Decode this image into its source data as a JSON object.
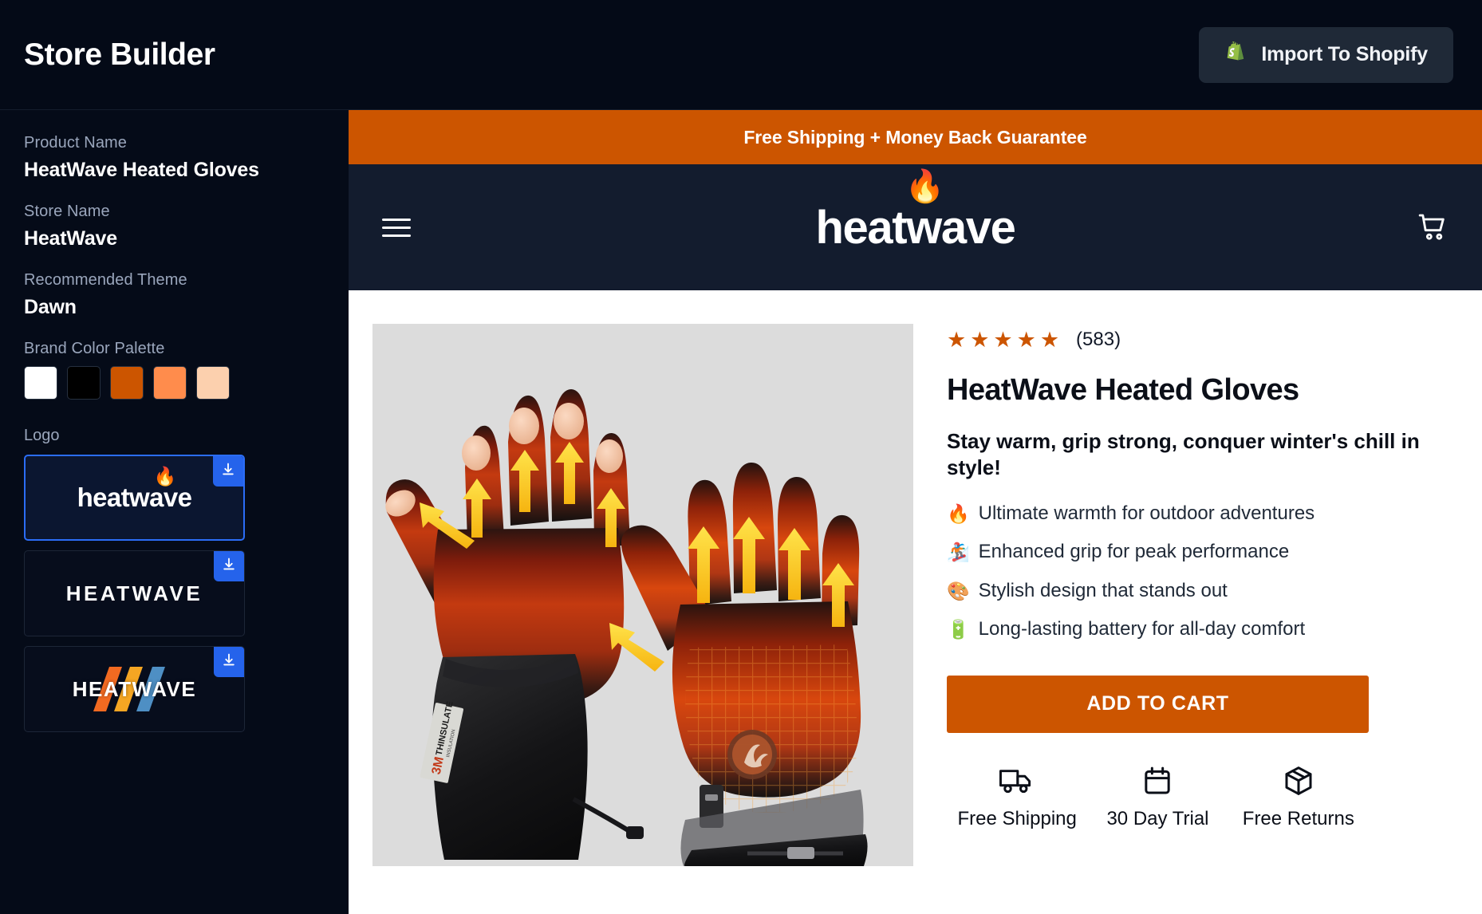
{
  "topbar": {
    "title": "Store Builder",
    "import_button": {
      "label": "Import To Shopify",
      "icon": "shopify-bag-icon"
    }
  },
  "sidebar": {
    "fields": [
      {
        "label": "Product Name",
        "value": "HeatWave Heated Gloves"
      },
      {
        "label": "Store Name",
        "value": "HeatWave"
      },
      {
        "label": "Recommended Theme",
        "value": "Dawn"
      }
    ],
    "palette": {
      "label": "Brand Color Palette",
      "colors": [
        "#FFFFFF",
        "#000000",
        "#CC5500",
        "#FF8C4C",
        "#FCD0AE"
      ]
    },
    "logo": {
      "label": "Logo",
      "items": [
        {
          "text": "heatwave",
          "style": "lowercase-flame",
          "selected": true,
          "download_label": "Download"
        },
        {
          "text": "HEATWAVE",
          "style": "uppercase-thin",
          "selected": false,
          "download_label": "Download"
        },
        {
          "text": "HEATWAVE",
          "style": "uppercase-wave-mark",
          "selected": false,
          "download_label": "Download"
        }
      ]
    }
  },
  "preview": {
    "promo_bar": "Free Shipping + Money Back Guarantee",
    "nav": {
      "menu_icon": "hamburger-icon",
      "logo_text": "heatwave",
      "cart_icon": "shopping-cart-icon"
    },
    "product": {
      "image_alt": "HeatWave Heated Gloves thermal heat-map product photo",
      "rating_stars": 5,
      "review_count": "(583)",
      "title": "HeatWave Heated Gloves",
      "tagline": "Stay warm, grip strong, conquer winter's chill in style!",
      "bullets": [
        {
          "emoji": "🔥",
          "text": "Ultimate warmth for outdoor adventures"
        },
        {
          "emoji": "🏂",
          "text": "Enhanced grip for peak performance"
        },
        {
          "emoji": "🎨",
          "text": "Stylish design that stands out"
        },
        {
          "emoji": "🔋",
          "text": "Long-lasting battery for all-day comfort"
        }
      ],
      "add_to_cart": "ADD TO CART",
      "trust_badges": [
        {
          "icon": "truck-icon",
          "label": "Free Shipping"
        },
        {
          "icon": "calendar-icon",
          "label": "30 Day Trial"
        },
        {
          "icon": "box-icon",
          "label": "Free Returns"
        }
      ]
    }
  },
  "colors": {
    "app_bg": "#050B18",
    "accent_orange": "#CC5500",
    "nav_navy": "#131C2E",
    "download_blue": "#2563EB",
    "selected_border": "#2B6DF6"
  }
}
